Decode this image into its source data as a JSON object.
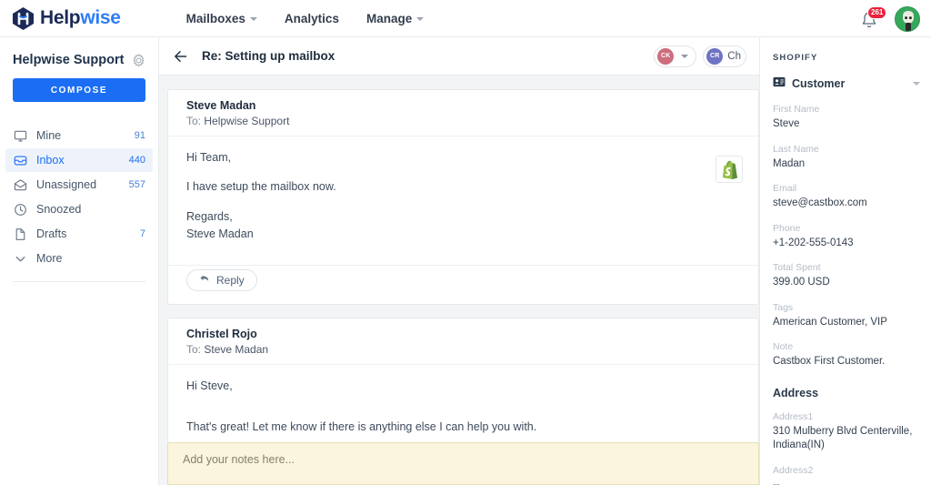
{
  "topbar": {
    "brand": {
      "name_a": "Help",
      "name_b": "wise",
      "logo_icon": "helpwise-logo-icon"
    },
    "nav": [
      {
        "label": "Mailboxes",
        "has_caret": true
      },
      {
        "label": "Analytics",
        "has_caret": false
      },
      {
        "label": "Manage",
        "has_caret": true
      }
    ],
    "notifications": {
      "icon": "bell-icon",
      "badge": "261"
    },
    "account_avatar": "user-avatar"
  },
  "sidebar": {
    "title": "Helpwise Support",
    "settings_icon": "gear-icon",
    "compose_label": "COMPOSE",
    "items": [
      {
        "label": "Mine",
        "count": "91",
        "icon": "monitor-icon",
        "active": false
      },
      {
        "label": "Inbox",
        "count": "440",
        "icon": "inbox-icon",
        "active": true
      },
      {
        "label": "Unassigned",
        "count": "557",
        "icon": "envelope-open-icon",
        "active": false
      },
      {
        "label": "Snoozed",
        "count": "",
        "icon": "clock-icon",
        "active": false
      },
      {
        "label": "Drafts",
        "count": "7",
        "icon": "file-icon",
        "active": false
      },
      {
        "label": "More",
        "count": "",
        "icon": "chevron-down-icon",
        "active": false
      }
    ]
  },
  "conversation": {
    "back_icon": "back-arrow-icon",
    "subject": "Re: Setting up mailbox",
    "chips": [
      {
        "initials": "CK",
        "label": "",
        "color": "#cd6d7e",
        "has_caret": true
      },
      {
        "initials": "CR",
        "label": "Ch",
        "color": "#6f73c4",
        "has_caret": false
      }
    ],
    "integration_icon": "shopify-icon",
    "messages": [
      {
        "from": "Steve Madan",
        "to_prefix": "To:",
        "to": "Helpwise Support",
        "paragraphs": [
          "Hi Team,",
          "I have setup the mailbox now.",
          "Regards,\nSteve Madan"
        ],
        "reply_label": "Reply",
        "reply_icon": "reply-arrow-icon",
        "has_reply": true
      },
      {
        "from": "Christel Rojo",
        "to_prefix": "To:",
        "to": "Steve Madan",
        "paragraphs": [
          "Hi Steve,",
          "",
          "That's great! Let me know if there is anything else I can help you with."
        ],
        "reply_label": "",
        "reply_icon": "",
        "has_reply": false
      }
    ],
    "notes_placeholder": "Add your notes here..."
  },
  "right_panel": {
    "title": "SHOPIFY",
    "section": {
      "title": "Customer",
      "icon": "contact-card-icon",
      "collapse_icon": "chevron-down-icon"
    },
    "fields": [
      {
        "label": "First Name",
        "value": "Steve"
      },
      {
        "label": "Last Name",
        "value": "Madan"
      },
      {
        "label": "Email",
        "value": "steve@castbox.com"
      },
      {
        "label": "Phone",
        "value": "+1-202-555-0143"
      },
      {
        "label": "Total Spent",
        "value": "399.00 USD"
      },
      {
        "label": "Tags",
        "value": "American Customer, VIP"
      },
      {
        "label": "Note",
        "value": "Castbox First Customer."
      }
    ],
    "address_heading": "Address",
    "address_fields": [
      {
        "label": "Address1",
        "value": "310 Mulberry Blvd Centerville, Indiana(IN)"
      },
      {
        "label": "Address2",
        "value": "--"
      }
    ]
  }
}
